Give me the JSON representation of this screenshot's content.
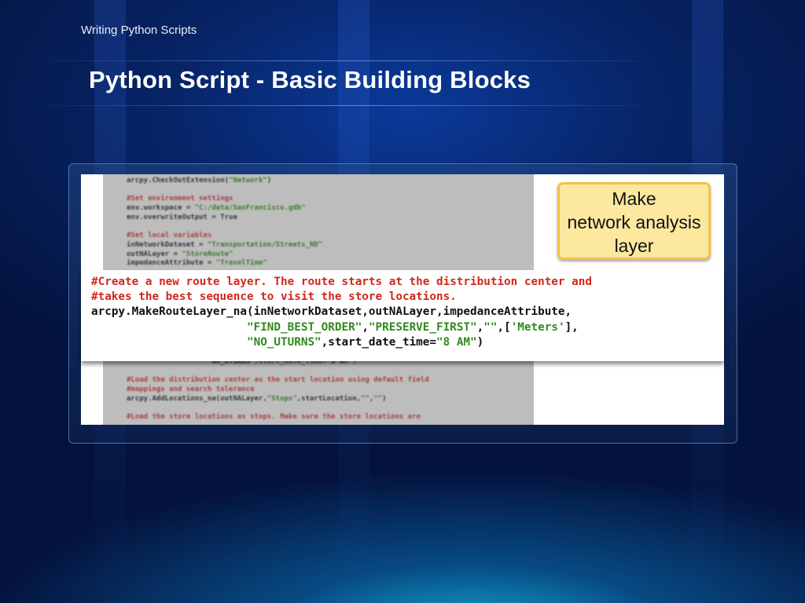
{
  "header": {
    "subtitle": "Writing Python Scripts",
    "title": "Python Script - Basic Building Blocks"
  },
  "callout": {
    "lines": [
      "Make",
      "network analysis",
      "layer"
    ]
  },
  "background_code": {
    "top_lines": [
      "arcpy.CheckOutExtension(\"Network\")",
      "",
      "#Set environment settings",
      "env.workspace = \"C:/data/SanFrancisco.gdb\"",
      "env.overwriteOutput = True",
      "",
      "#Set local variables",
      "inNetworkDataset = \"Transportation/Streets_ND\"",
      "outNALayer = \"StoreRoute\"",
      "impedanceAttribute = \"TravelTime\""
    ],
    "bottom_lines": [
      "                    NO_UTURNS\",start_date_time=\"8 AM\")",
      "",
      "#Load the distribution center as the start location using default field",
      "#mappings and search tolerance",
      "arcpy.AddLocations_na(outNALayer,\"Stops\",startLocation,\"\",\"\")",
      "",
      "#Load the store locations as stops. Make sure the store locations are"
    ]
  },
  "zoomed_code": {
    "comment1": "#Create a new route layer. The route starts at the distribution center and",
    "comment2": "#takes the best sequence to visit the store locations.",
    "call": "arcpy.MakeRouteLayer_na(inNetworkDataset,outNALayer,impedanceAttribute,",
    "arg_indent": "                       ",
    "arg1": "\"FIND_BEST_ORDER\"",
    "sep1": ",",
    "arg2": "\"PRESERVE_FIRST\"",
    "sep2": ",",
    "arg3": "\"\"",
    "sep3": ",[",
    "arg4": "'Meters'",
    "sep4": "],",
    "arg5": "\"NO_UTURNS\"",
    "sep5": ",start_date_time=",
    "arg6": "\"8 AM\"",
    "close": ")"
  },
  "colors": {
    "comment": "#d0281c",
    "string": "#2f8a1c",
    "callout_fill": "#fde8a0",
    "callout_border": "#f3c24a"
  }
}
